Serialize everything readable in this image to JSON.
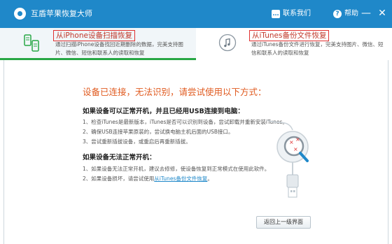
{
  "titlebar": {
    "app_title": "互盾苹果恢复大师",
    "contact_label": "联系我们",
    "help_label": "帮助",
    "minimize_glyph": "—",
    "close_glyph": "✕",
    "background_color": "#1f88c9"
  },
  "tabs": [
    {
      "title": "从iPhone设备扫描恢复",
      "description": "通过扫描iPhone设备找回近期删除的数据，完美支持图片、微信、短信和联系人的读取和恢复",
      "icon": "phone-scan-icon",
      "active": true
    },
    {
      "title": "从iTunes备份文件恢复",
      "description": "通过iTunes备份文件进行恢复，完美支持图片、微信、短信和联系人的读取和恢复",
      "icon": "music-note-icon",
      "active": false
    }
  ],
  "main": {
    "headline": "设备已连接，无法识别，请尝试使用以下方式：",
    "section1": {
      "title": "如果设备可以正常开机，并且已经用USB连接到电脑：",
      "items": [
        "1、检查iTunes是最新版本，iTunes是否可以识别到设备，尝试卸载并重新安装iTunes。",
        "2、确保USB连接苹果原装的，尝试换电脑主机后面的USB接口。",
        "3、尝试重新插拔设备，或重启后再重新插拔。"
      ]
    },
    "section2": {
      "title": "如果设备无法正常开机：",
      "items": [
        "1、如果设备无法正常开机，建议去修修，使设备恢复到正常模式在使用此软件。",
        "2、如果设备损坏，请尝试使用"
      ],
      "link_text": "从iTunes备份文件恢复",
      "link_suffix": "。"
    },
    "illustration_icon": "usb-magnifier-icon",
    "back_button_label": "返回上一级界面"
  },
  "colors": {
    "accent": "#1f88c9",
    "headline": "#e05a1f",
    "highlight_border": "#e03030",
    "active_tab_underline": "#28a745"
  }
}
